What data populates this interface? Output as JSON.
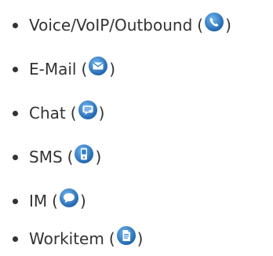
{
  "media_types": [
    {
      "label": "Voice/VoIP/Outbound",
      "open": "(",
      "close": ")",
      "icon": "voice-phone-icon"
    },
    {
      "label": "E-Mail",
      "open": "(",
      "close": ")",
      "icon": "email-envelope-icon"
    },
    {
      "label": "Chat",
      "open": "(",
      "close": ")",
      "icon": "chat-bubble-icon"
    },
    {
      "label": "SMS",
      "open": "(",
      "close": ")",
      "icon": "sms-mobile-icon"
    },
    {
      "label": "IM",
      "open": "(",
      "close": ")",
      "icon": "im-bubble-icon"
    },
    {
      "label": "Workitem",
      "open": "(",
      "close": ")",
      "icon": "workitem-document-icon"
    }
  ],
  "colors": {
    "text": "#333333",
    "icon_blue": "#2b7fd0",
    "icon_blue_dark": "#1a5ea8",
    "icon_white": "#ffffff"
  }
}
